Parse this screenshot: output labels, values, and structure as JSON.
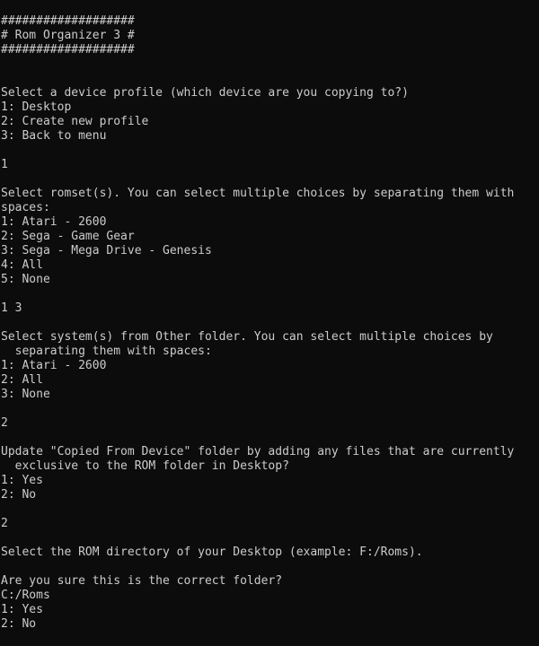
{
  "colors": {
    "background": "#0c0c0c",
    "foreground": "#cccccc"
  },
  "header": {
    "border_top": "###################",
    "title": "# Rom Organizer 3 #",
    "border_bottom": "###################"
  },
  "profile_prompt": {
    "question": "Select a device profile (which device are you copying to?)",
    "options": [
      "1: Desktop",
      "2: Create new profile",
      "3: Back to menu"
    ],
    "answer": "1"
  },
  "romset_prompt": {
    "question_line1": "Select romset(s). You can select multiple choices by separating them with",
    "question_line2": "spaces:",
    "options": [
      "1: Atari - 2600",
      "2: Sega - Game Gear",
      "3: Sega - Mega Drive - Genesis",
      "4: All",
      "5: None"
    ],
    "answer": "1 3"
  },
  "other_prompt": {
    "question_line1": "Select system(s) from Other folder. You can select multiple choices by",
    "question_line2": "  separating them with spaces:",
    "options": [
      "1: Atari - 2600",
      "2: All",
      "3: None"
    ],
    "answer": "2"
  },
  "update_prompt": {
    "question_line1": "Update \"Copied From Device\" folder by adding any files that are currently",
    "question_line2": "  exclusive to the ROM folder in Desktop?",
    "options": [
      "1: Yes",
      "2: No"
    ],
    "answer": "2"
  },
  "directory_prompt": {
    "question": "Select the ROM directory of your Desktop (example: F:/Roms)."
  },
  "confirm_prompt": {
    "question": "Are you sure this is the correct folder?",
    "path": "C:/Roms",
    "options": [
      "1: Yes",
      "2: No"
    ]
  }
}
